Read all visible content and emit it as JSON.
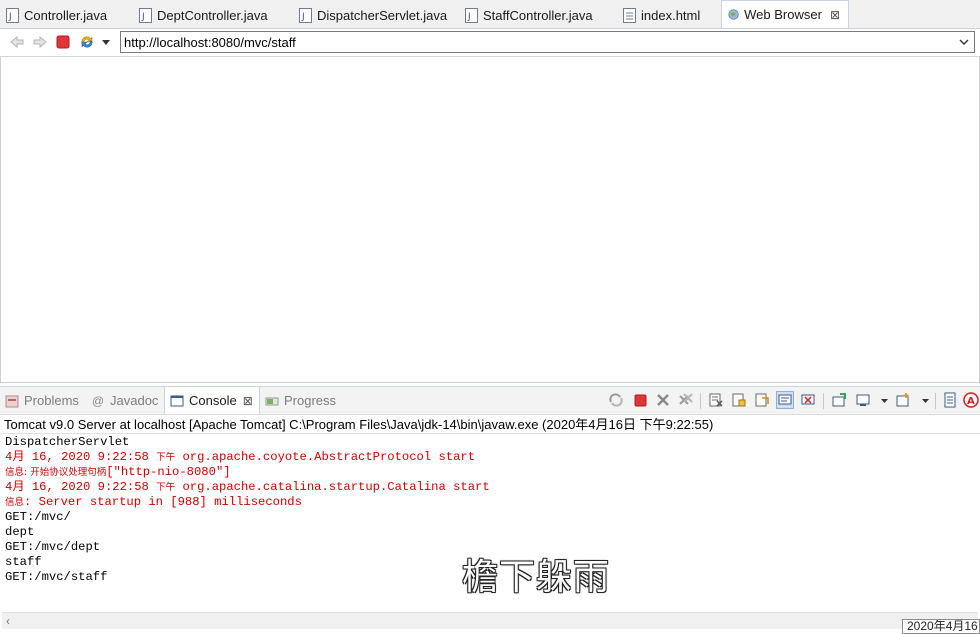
{
  "editor_tabs": [
    {
      "label": "Controller.java",
      "icon": "java-file-icon"
    },
    {
      "label": "DeptController.java",
      "icon": "java-file-icon"
    },
    {
      "label": "DispatcherServlet.java",
      "icon": "java-file-icon"
    },
    {
      "label": "StaffController.java",
      "icon": "java-file-icon"
    },
    {
      "label": "index.html",
      "icon": "html-file-icon"
    },
    {
      "label": "Web Browser",
      "icon": "globe-icon",
      "active": true,
      "close": "⊠"
    }
  ],
  "browser": {
    "url": "http://localhost:8080/mvc/staff",
    "buttons": [
      "back-icon",
      "forward-icon",
      "stop-icon",
      "refresh-icon",
      "menu-dropdown-icon"
    ]
  },
  "panel_tabs": [
    {
      "label": "Problems",
      "icon": "problems-icon"
    },
    {
      "label": "Javadoc",
      "icon": "at-icon"
    },
    {
      "label": "Console",
      "icon": "console-icon",
      "active": true,
      "close": "⊠"
    },
    {
      "label": "Progress",
      "icon": "progress-icon"
    }
  ],
  "console": {
    "header": "Tomcat v9.0 Server at localhost [Apache Tomcat] C:\\Program Files\\Java\\jdk-14\\bin\\javaw.exe (2020年4月16日 下午9:22:55)",
    "lines": [
      {
        "type": "out",
        "text": "DispatcherServlet"
      },
      {
        "type": "err",
        "prefix": "4月 16, 2020 9:22:58 ",
        "small": "下午",
        "text": " org.apache.coyote.AbstractProtocol start"
      },
      {
        "type": "err",
        "prefix": "",
        "small": "信息: 开始协议处理句柄",
        "text": "[\"http-nio-8080\"]"
      },
      {
        "type": "err",
        "prefix": "4月 16, 2020 9:22:58 ",
        "small": "下午",
        "text": " org.apache.catalina.startup.Catalina start"
      },
      {
        "type": "err",
        "prefix": "",
        "small": "信息",
        "text": ": Server startup in [988] milliseconds"
      },
      {
        "type": "out",
        "text": "GET:/mvc/"
      },
      {
        "type": "out",
        "text": "dept"
      },
      {
        "type": "out",
        "text": "GET:/mvc/dept"
      },
      {
        "type": "out",
        "text": "staff"
      },
      {
        "type": "out",
        "text": "GET:/mvc/staff"
      }
    ]
  },
  "subtitle": "檐下躲雨",
  "clock": "2020年4月16",
  "colors": {
    "error": "#d00000",
    "accent": "#3a6ea5"
  }
}
